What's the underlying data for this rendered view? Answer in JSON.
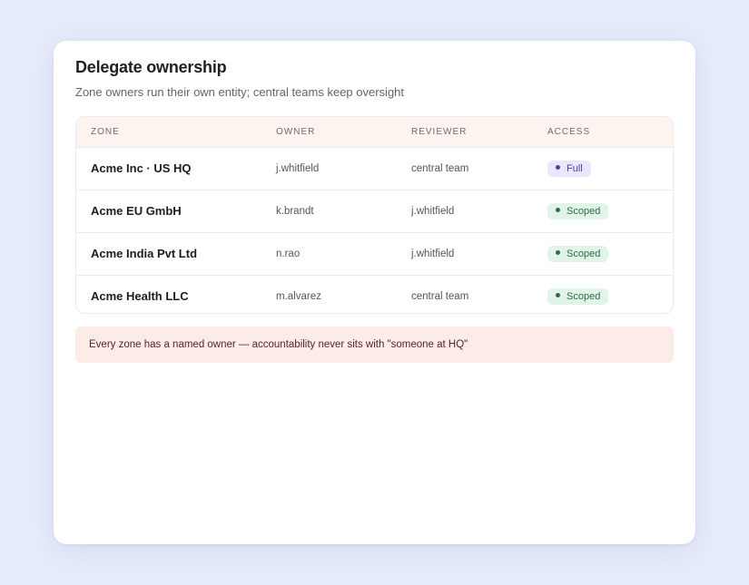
{
  "card": {
    "title": "Delegate ownership",
    "subtitle": "Zone owners run their own entity; central teams keep oversight"
  },
  "table": {
    "columns": [
      "ZONE",
      "OWNER",
      "REVIEWER",
      "ACCESS"
    ],
    "rows": [
      {
        "zone": "Acme Inc · US HQ",
        "owner": "j.whitfield",
        "reviewer": "central team",
        "access": "Full"
      },
      {
        "zone": "Acme EU GmbH",
        "owner": "k.brandt",
        "reviewer": "j.whitfield",
        "access": "Scoped"
      },
      {
        "zone": "Acme India Pvt Ltd",
        "owner": "n.rao",
        "reviewer": "j.whitfield",
        "access": "Scoped"
      },
      {
        "zone": "Acme Health LLC",
        "owner": "m.alvarez",
        "reviewer": "central team",
        "access": "Scoped"
      }
    ]
  },
  "note": {
    "text": "Every zone has a named owner — accountability never sits with \"someone at HQ\""
  },
  "colors": {
    "background": "#e6ecfb",
    "header_bg": "#fdf4f0",
    "badge_full_bg": "#ebe6fb",
    "badge_full_fg": "#4f3da8",
    "badge_scoped_bg": "#e2f3e8",
    "badge_scoped_fg": "#2a6e45",
    "note_bg": "#fbece7",
    "note_fg": "#5a2230"
  }
}
